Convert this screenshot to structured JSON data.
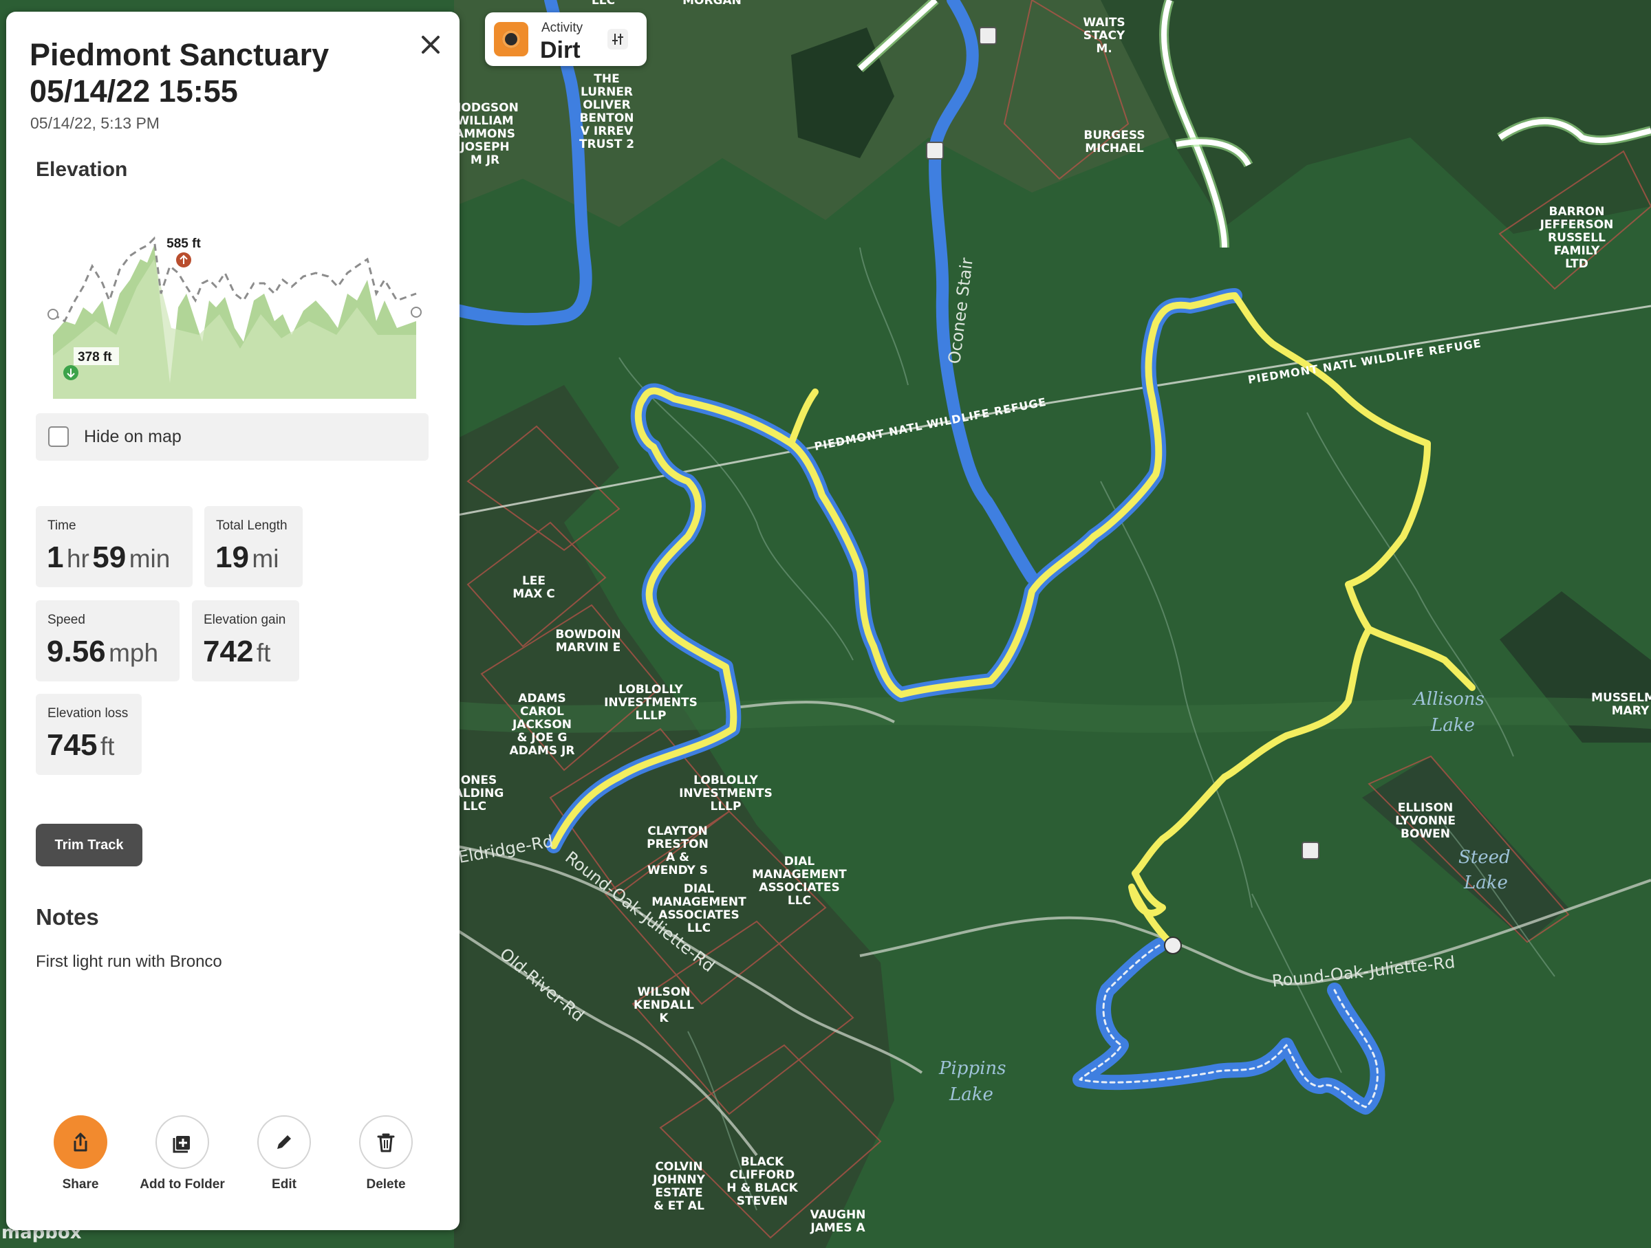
{
  "track": {
    "title": "Piedmont Sanctuary 05/14/22 15:55",
    "timestamp": "05/14/22, 5:13 PM"
  },
  "elevation": {
    "heading": "Elevation",
    "max_label": "585 ft",
    "min_label": "378 ft",
    "max_ft": 585,
    "min_ft": 378
  },
  "hide_on_map": {
    "label": "Hide on map",
    "checked": false
  },
  "stats": {
    "time": {
      "label": "Time",
      "hours": "1",
      "hours_unit": "hr",
      "minutes": "59",
      "minutes_unit": "min"
    },
    "total_length": {
      "label": "Total Length",
      "value": "19",
      "unit": "mi"
    },
    "speed": {
      "label": "Speed",
      "value": "9.56",
      "unit": "mph"
    },
    "elevation_gain": {
      "label": "Elevation gain",
      "value": "742",
      "unit": "ft"
    },
    "elevation_loss": {
      "label": "Elevation loss",
      "value": "745",
      "unit": "ft"
    }
  },
  "trim_label": "Trim Track",
  "notes": {
    "heading": "Notes",
    "text": "First light run with Bronco"
  },
  "actions": {
    "share": "Share",
    "add_to_folder": "Add to Folder",
    "edit": "Edit",
    "delete": "Delete"
  },
  "activity": {
    "label": "Activity",
    "value": "Dirt",
    "accent": "#ef8c2b"
  },
  "colors": {
    "accent": "#f28a2e",
    "track_blue": "#3f7fe0",
    "track_yellow": "#f3ee5f",
    "map_green": "#2f6b3a"
  },
  "map": {
    "attribution": "mapbox",
    "area_labels": [
      "PIEDMONT NATL WILDLIFE REFUGE",
      "PIEDMONT NATL WILDLIFE REFUGE",
      "Oconee Stair",
      "Round-Oak-Juliette-Rd",
      "Round-Oak-Juliette-Rd",
      "Old-River-Rd",
      "Eldridge-Rd",
      "Allisons Lake",
      "Pippins Lake",
      "Steed Lake"
    ],
    "parcels": [
      "THE LURNER OLIVER BENTON V IRREV TRUST 2",
      "HODGSON WILLIAM AMMONS JOSEPH M JR",
      "WAITS STACY M.",
      "BURGESS MICHAEL",
      "BARRON JEFFERSON RUSSELL FAMILY LTD",
      "LEE MAX C",
      "BOWDOIN MARVIN E",
      "LOBLOLLY INVESTMENTS LLLP",
      "ADAMS CAROL JACKSON & JOE G ADAMS JR",
      "LOBLOLLY INVESTMENTS LLLP",
      "CLAYTON PRESTON A & WENDY S",
      "DIAL MANAGEMENT ASSOCIATES LLC",
      "DIAL MANAGEMENT ASSOCIATES LLC",
      "WILSON KENDALL K",
      "COLVIN JOHNNY ESTATE & ET AL",
      "BLACK CLIFFORD H & BLACK STEVEN",
      "VAUGHN JAMES A",
      "ELLISON LYVONNE BOWEN",
      "MUSSELM MARY",
      "JONES ALDING LLC",
      "MORGAN",
      "LLC"
    ]
  }
}
